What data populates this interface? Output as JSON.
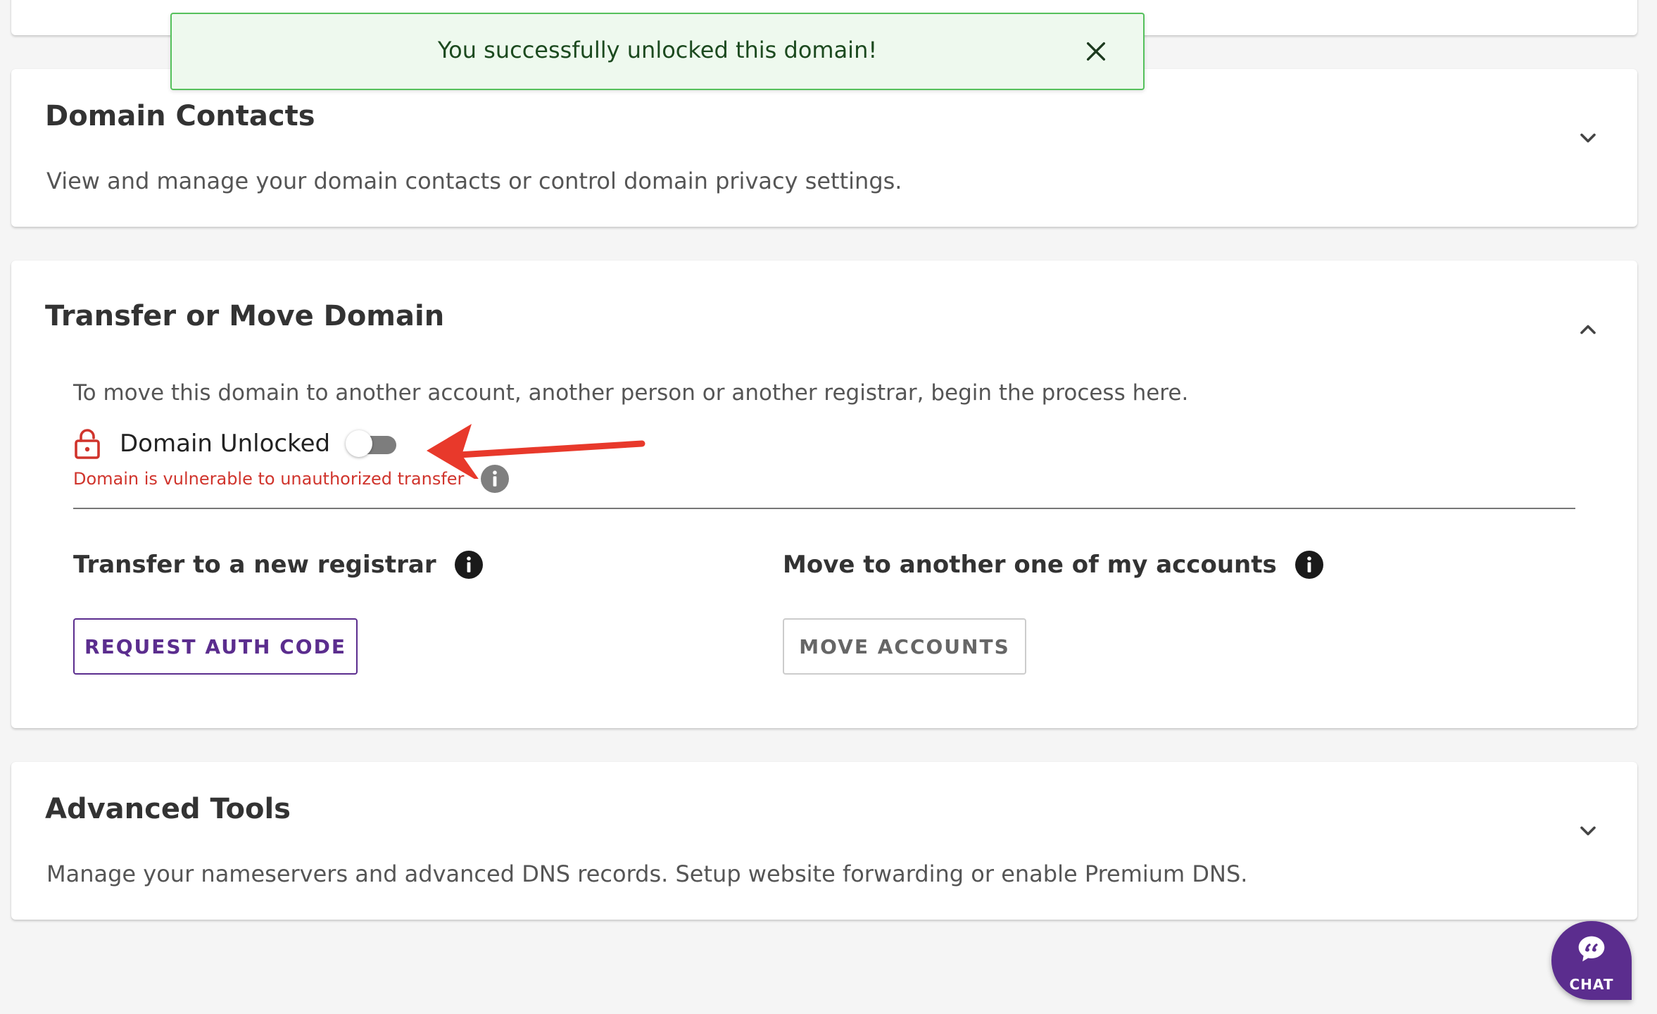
{
  "toast": {
    "message": "You successfully unlocked this domain!",
    "close_icon": "close-icon",
    "color": "#55c15c"
  },
  "contacts": {
    "title": "Domain Contacts",
    "description": "View and manage your domain contacts or control domain privacy settings.",
    "chevron_icon": "chevron-down-icon"
  },
  "transfer": {
    "title": "Transfer or Move Domain",
    "description": "To move this domain to another account, another person or another registrar, begin the process here.",
    "chevron_icon": "chevron-up-icon",
    "lock": {
      "icon": "unlocked-padlock-icon",
      "label": "Domain Unlocked",
      "toggle_on": false,
      "warning": "Domain is vulnerable to unauthorized transfer",
      "warning_color": "#d0342c"
    },
    "registrar": {
      "heading": "Transfer to a new registrar",
      "button_label": "REQUEST AUTH CODE"
    },
    "accounts": {
      "heading": "Move to another one of my accounts",
      "button_label": "MOVE ACCOUNTS"
    }
  },
  "advanced": {
    "title": "Advanced Tools",
    "description": "Manage your nameservers and advanced DNS records. Setup website forwarding or enable Premium DNS.",
    "chevron_icon": "chevron-down-icon"
  },
  "chat": {
    "label": "CHAT",
    "icon": "chat-bubble-icon",
    "color": "#5b2d8e"
  }
}
